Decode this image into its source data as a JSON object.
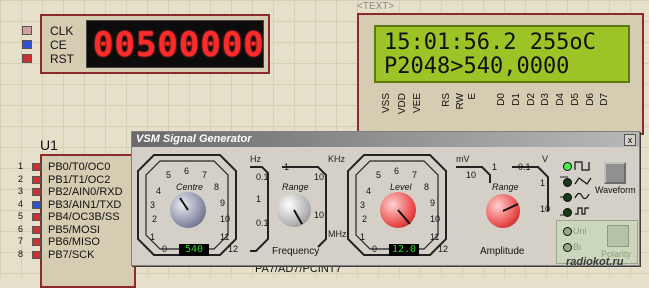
{
  "counter": {
    "pins": [
      "CLK",
      "CE",
      "RST"
    ],
    "display": "00500000"
  },
  "lcd": {
    "tag": "<TEXT>",
    "line1": "15:01:56.2 255oC",
    "line2": "P2048>540,0000",
    "pins": [
      "VSS",
      "VDD",
      "VEE",
      "RS",
      "RW",
      "E",
      "D0",
      "D1",
      "D2",
      "D3",
      "D4",
      "D5",
      "D6",
      "D7"
    ]
  },
  "u1": {
    "title": "U1",
    "pins": [
      "PB0/T0/OC0",
      "PB1/T1/OC2",
      "PB2/AIN0/RXD",
      "PB3/AIN1/TXD",
      "PB4/OC3B/SS",
      "PB5/MOSI",
      "PB6/MISO",
      "PB7/SCK"
    ],
    "numbers": [
      "1",
      "2",
      "3",
      "4",
      "5",
      "6",
      "7",
      "8"
    ],
    "bottom_pin": "PA7/AD7/PCINT7"
  },
  "generator": {
    "title": "VSM Signal Generator",
    "close": "x",
    "freq": {
      "units_left": "Hz",
      "units_right": "KHz",
      "units_mhz": "MHz",
      "centre_label": "Centre",
      "range_label": "Range",
      "centre_value": "540",
      "caption": "Frequency",
      "centre_scale": [
        "2",
        "3",
        "4",
        "5",
        "6",
        "7",
        "8",
        "9",
        "10",
        "11",
        "0",
        "1",
        "12"
      ],
      "range_scale": [
        "0.1",
        "1",
        "10",
        "1",
        "0.1",
        "10"
      ]
    },
    "amp": {
      "units_left": "mV",
      "units_right": "V",
      "level_label": "Level",
      "range_label": "Range",
      "level_value": "12.0",
      "caption": "Amplitude",
      "level_scale": [
        "2",
        "3",
        "4",
        "5",
        "6",
        "7",
        "8",
        "9",
        "10",
        "11",
        "0",
        "1",
        "12"
      ],
      "range_scale": [
        "10",
        "1",
        "0.1",
        "1",
        "10"
      ]
    },
    "waveform": {
      "label": "Waveform",
      "options": [
        "square",
        "triangle",
        "sine",
        "pulse"
      ]
    },
    "lower": {
      "uni": "Uni",
      "bi": "Bi",
      "polarity": "Polarity"
    }
  },
  "watermark": "radiokot.ru",
  "colors": {
    "counter_digits": "#ff2a2a",
    "lcd_background": "#9cc427",
    "readout_text": "#2fd42f",
    "frame": "#8a2a2a"
  }
}
